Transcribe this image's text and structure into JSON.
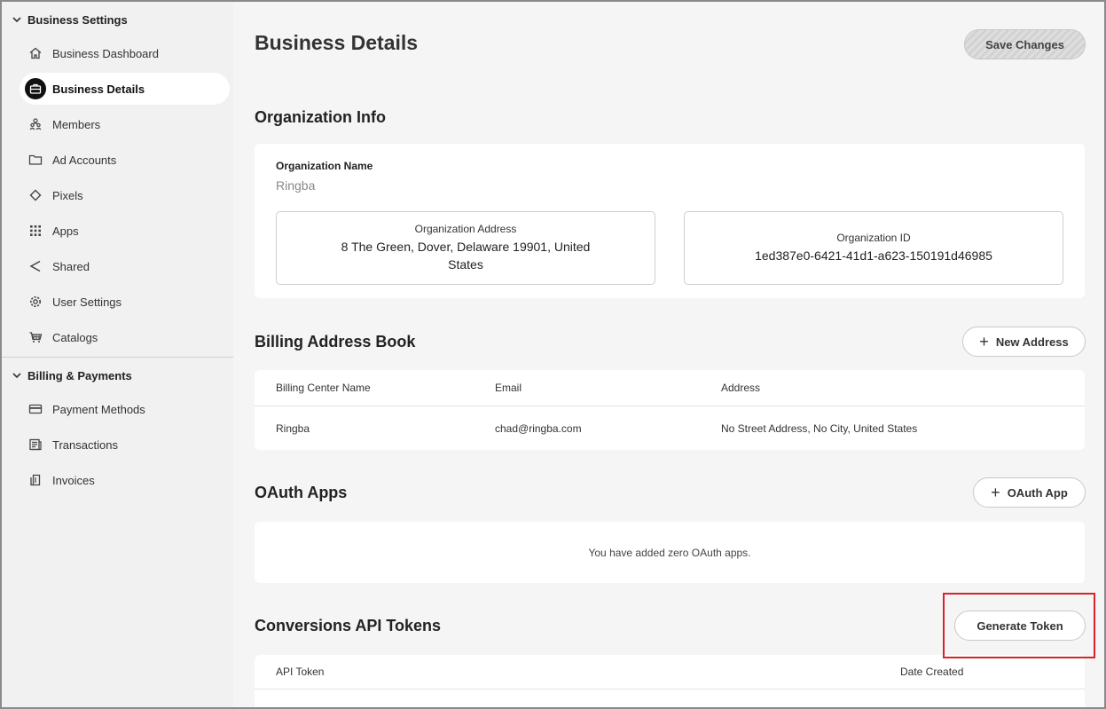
{
  "sidebar": {
    "groups": [
      {
        "title": "Business Settings",
        "items": [
          {
            "label": "Business Dashboard",
            "icon": "home-icon"
          },
          {
            "label": "Business Details",
            "icon": "briefcase-icon",
            "active": true
          },
          {
            "label": "Members",
            "icon": "members-icon"
          },
          {
            "label": "Ad Accounts",
            "icon": "folder-icon"
          },
          {
            "label": "Pixels",
            "icon": "diamond-icon"
          },
          {
            "label": "Apps",
            "icon": "grid-icon"
          },
          {
            "label": "Shared",
            "icon": "share-icon"
          },
          {
            "label": "User Settings",
            "icon": "gear-icon"
          },
          {
            "label": "Catalogs",
            "icon": "cart-icon"
          }
        ]
      },
      {
        "title": "Billing & Payments",
        "items": [
          {
            "label": "Payment Methods",
            "icon": "card-icon"
          },
          {
            "label": "Transactions",
            "icon": "receipt-icon"
          },
          {
            "label": "Invoices",
            "icon": "invoice-icon"
          }
        ]
      }
    ]
  },
  "header": {
    "title": "Business Details",
    "save_label": "Save Changes"
  },
  "org_info": {
    "title": "Organization Info",
    "name_label": "Organization Name",
    "name_value": "Ringba",
    "address_label": "Organization Address",
    "address_line1": "8 The Green, Dover, Delaware 19901, United",
    "address_line2": "States",
    "id_label": "Organization ID",
    "id_value": "1ed387e0-6421-41d1-a623-150191d46985"
  },
  "billing": {
    "title": "Billing Address Book",
    "new_button": "New Address",
    "columns": [
      "Billing Center Name",
      "Email",
      "Address"
    ],
    "rows": [
      [
        "Ringba",
        "chad@ringba.com",
        "No Street Address, No City, United States"
      ]
    ]
  },
  "oauth": {
    "title": "OAuth Apps",
    "button": "OAuth App",
    "empty": "You have added zero OAuth apps."
  },
  "tokens": {
    "title": "Conversions API Tokens",
    "button": "Generate Token",
    "columns": [
      "API Token",
      "Date Created"
    ]
  },
  "colors": {
    "sidebar_bg": "#f1f1f1",
    "main_bg": "#f5f5f5",
    "highlight": "#d9232a"
  }
}
